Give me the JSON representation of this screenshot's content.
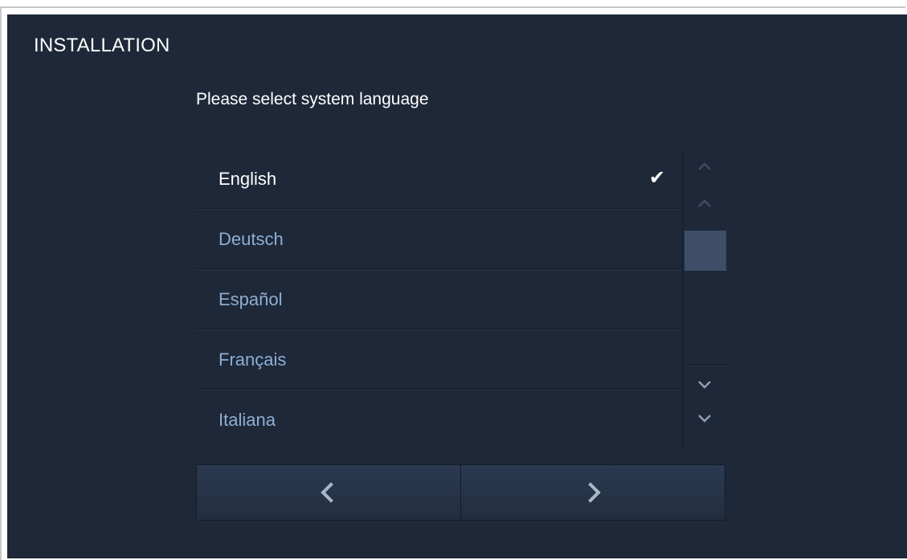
{
  "screen": {
    "title": "INSTALLATION",
    "prompt": "Please select system language"
  },
  "languages": [
    {
      "label": "English",
      "selected": true
    },
    {
      "label": "Deutsch",
      "selected": false
    },
    {
      "label": "Español",
      "selected": false
    },
    {
      "label": "Français",
      "selected": false
    },
    {
      "label": "Italiana",
      "selected": false
    }
  ],
  "selected_mark": "✔",
  "scrollbar": {
    "top_icon": "chevron-up-double-icon",
    "bottom_icon": "chevron-down-double-icon"
  },
  "nav": {
    "prev_icon": "chevron-left-icon",
    "next_icon": "chevron-right-icon"
  },
  "colors": {
    "background": "#1e2838",
    "selected_text": "#ffffff",
    "option_text": "#8eaed4"
  }
}
